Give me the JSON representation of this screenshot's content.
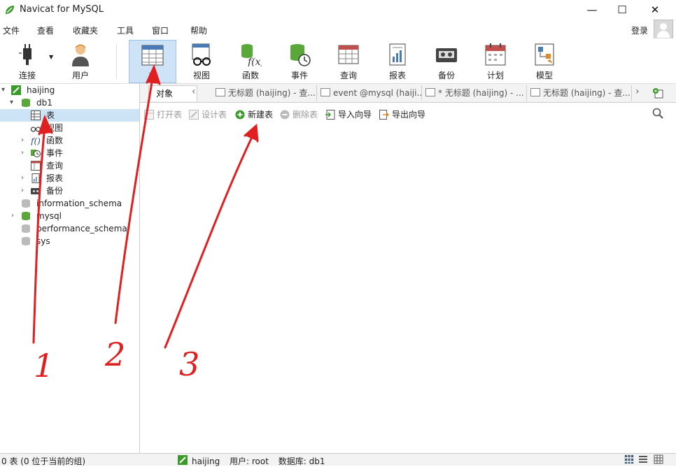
{
  "window": {
    "title": "Navicat for MySQL",
    "minimize": "—",
    "maximize": "☐",
    "close": "✕"
  },
  "menu": {
    "items": [
      "文件",
      "查看",
      "收藏夹",
      "工具",
      "窗口",
      "帮助"
    ],
    "login": "登录"
  },
  "toolbar": {
    "items": [
      {
        "label": "连接",
        "icon": "connection-plug-icon"
      },
      {
        "label": "用户",
        "icon": "user-icon"
      },
      {
        "label": "表",
        "icon": "table-icon",
        "active": true
      },
      {
        "label": "视图",
        "icon": "view-glasses-icon"
      },
      {
        "label": "函数",
        "icon": "function-icon"
      },
      {
        "label": "事件",
        "icon": "event-clock-icon"
      },
      {
        "label": "查询",
        "icon": "query-icon"
      },
      {
        "label": "报表",
        "icon": "report-icon"
      },
      {
        "label": "备份",
        "icon": "backup-icon"
      },
      {
        "label": "计划",
        "icon": "schedule-calendar-icon"
      },
      {
        "label": "模型",
        "icon": "model-icon"
      }
    ]
  },
  "tree": {
    "connection": "haijing",
    "database": "db1",
    "children": [
      "表",
      "视图",
      "函数",
      "事件",
      "查询",
      "报表",
      "备份"
    ],
    "other_dbs": [
      "information_schema",
      "mysql",
      "performance_schema",
      "sys"
    ]
  },
  "tabs": {
    "object": "对象",
    "items": [
      "无标题 (haijing) - 查...",
      "event @mysql (haiji...",
      "* 无标题 (haijing) - ...",
      "无标题 (haijing) - 查..."
    ]
  },
  "objbar": {
    "open": "打开表",
    "design": "设计表",
    "new": "新建表",
    "delete": "删除表",
    "import": "导入向导",
    "export": "导出向导"
  },
  "status": {
    "left": "0 表 (0 位于当前的组)",
    "connection": "haijing",
    "user": "用户: root",
    "database": "数据库: db1"
  },
  "annotations": {
    "one": "1",
    "two": "2",
    "three": "3",
    "color": "#e02020"
  },
  "colors": {
    "accent": "#cfe3f7",
    "navicat_green": "#3a9a2a",
    "db_green": "#5aa83a"
  }
}
